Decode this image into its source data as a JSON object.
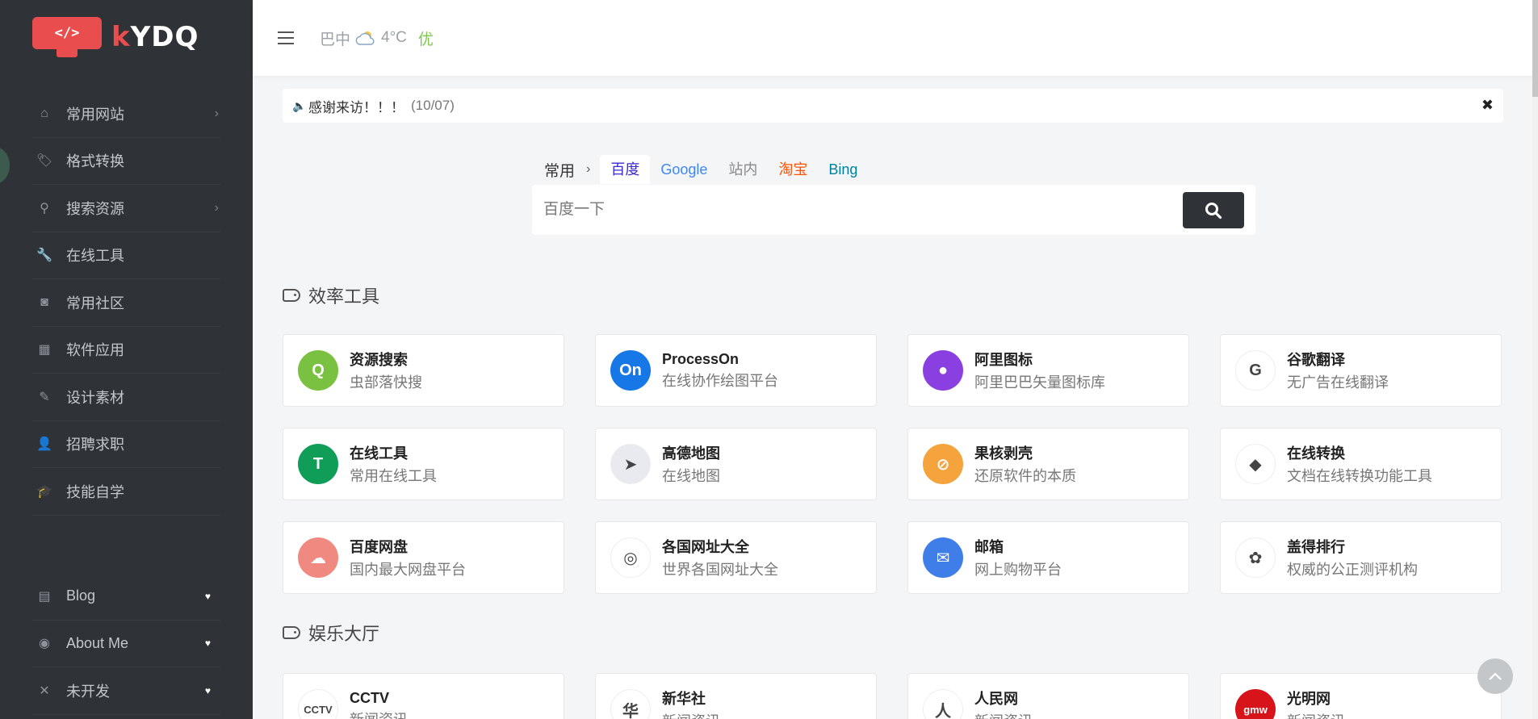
{
  "logo": {
    "mark_text": "</>",
    "brand": "KYDQ"
  },
  "sidebar": {
    "items": [
      {
        "label": "常用网站",
        "icon": "home-icon",
        "has_arrow": true
      },
      {
        "label": "格式转换",
        "icon": "tags-icon",
        "has_arrow": false
      },
      {
        "label": "搜索资源",
        "icon": "search-icon",
        "has_arrow": true
      },
      {
        "label": "在线工具",
        "icon": "wrench-icon",
        "has_arrow": false
      },
      {
        "label": "常用社区",
        "icon": "community-icon",
        "has_arrow": false
      },
      {
        "label": "软件应用",
        "icon": "windows-icon",
        "has_arrow": false
      },
      {
        "label": "设计素材",
        "icon": "edit-icon",
        "has_arrow": false
      },
      {
        "label": "招聘求职",
        "icon": "user-plus-icon",
        "has_arrow": false
      },
      {
        "label": "技能自学",
        "icon": "graduation-cap-icon",
        "has_arrow": false
      }
    ],
    "bottom_items": [
      {
        "label": "Blog",
        "icon": "archive-icon"
      },
      {
        "label": "About Me",
        "icon": "user-circle-icon"
      },
      {
        "label": "未开发",
        "icon": "close-icon"
      }
    ]
  },
  "topbar": {
    "city": "巴中",
    "temperature": "4°C",
    "aqi": "优"
  },
  "notice": {
    "text": "感谢来访！！！",
    "date": "(10/07)"
  },
  "search": {
    "group": "常用",
    "tabs": [
      {
        "label": "百度",
        "color": "#3b2bd6"
      },
      {
        "label": "Google",
        "color": "#4285f4"
      },
      {
        "label": "站内",
        "color": "#888888"
      },
      {
        "label": "淘宝",
        "color": "#ff5000"
      },
      {
        "label": "Bing",
        "color": "#00809d"
      }
    ],
    "active_tab": "百度",
    "placeholder": "百度一下"
  },
  "sections": [
    {
      "title": "效率工具",
      "cards": [
        {
          "name": "资源搜索",
          "desc": "虫部落快搜",
          "icon": "q-search-icon",
          "color": "#7ac142",
          "glyph": "Q"
        },
        {
          "name": "ProcessOn",
          "desc": "在线协作绘图平台",
          "icon": "processon-icon",
          "color": "#1677e6",
          "glyph": "On"
        },
        {
          "name": "阿里图标",
          "desc": "阿里巴巴矢量图标库",
          "icon": "iconfont-icon",
          "color": "#8a3fe0",
          "glyph": "●"
        },
        {
          "name": "谷歌翻译",
          "desc": "无广告在线翻译",
          "icon": "google-icon",
          "color": "#ffffff",
          "glyph": "G"
        },
        {
          "name": "在线工具",
          "desc": "常用在线工具",
          "icon": "t-tool-icon",
          "color": "#0f9d58",
          "glyph": "T"
        },
        {
          "name": "高德地图",
          "desc": "在线地图",
          "icon": "paper-plane-icon",
          "color": "#e8eaf0",
          "glyph": "➤"
        },
        {
          "name": "果核剥壳",
          "desc": "还原软件的本质",
          "icon": "no-sign-icon",
          "color": "#f5a33d",
          "glyph": "⊘"
        },
        {
          "name": "在线转换",
          "desc": "文档在线转换功能工具",
          "icon": "convert-icon",
          "color": "#ffffff",
          "glyph": "◆"
        },
        {
          "name": "百度网盘",
          "desc": "国内最大网盘平台",
          "icon": "baidu-pan-icon",
          "color": "#f08a80",
          "glyph": "☁"
        },
        {
          "name": "各国网址大全",
          "desc": "世界各国网址大全",
          "icon": "globe-icon",
          "color": "#ffffff",
          "glyph": "◎"
        },
        {
          "name": "邮箱",
          "desc": "网上购物平台",
          "icon": "mail-icon",
          "color": "#3f7ee8",
          "glyph": "✉"
        },
        {
          "name": "盖得排行",
          "desc": "权威的公正测评机构",
          "icon": "guidebook-icon",
          "color": "#ffffff",
          "glyph": "✿"
        }
      ]
    },
    {
      "title": "娱乐大厅",
      "cards": [
        {
          "name": "CCTV",
          "desc": "新闻资讯",
          "icon": "cctv-icon",
          "color": "#ffffff",
          "glyph": "CCTV"
        },
        {
          "name": "新华社",
          "desc": "新闻资讯",
          "icon": "xinhua-icon",
          "color": "#ffffff",
          "glyph": "华"
        },
        {
          "name": "人民网",
          "desc": "新闻资讯",
          "icon": "people-icon",
          "color": "#ffffff",
          "glyph": "人"
        },
        {
          "name": "光明网",
          "desc": "新闻资讯",
          "icon": "gmw-icon",
          "color": "#d7141a",
          "glyph": "gmw"
        }
      ]
    }
  ]
}
